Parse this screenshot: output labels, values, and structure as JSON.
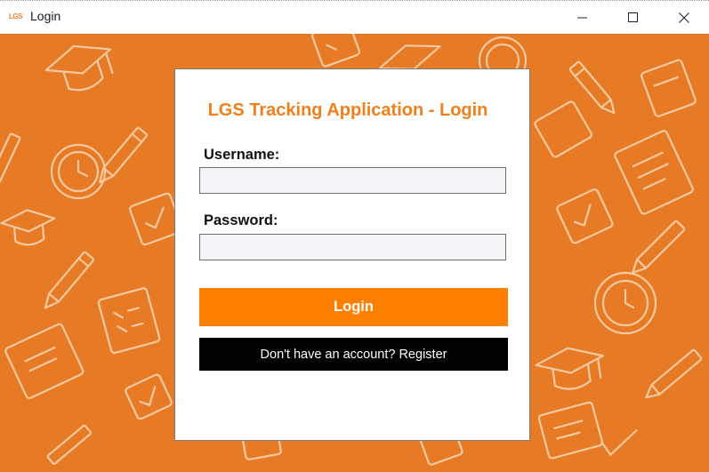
{
  "window": {
    "title": "Login",
    "logo_text": "LGS",
    "icons": {
      "minimize": "minimize-icon",
      "maximize": "maximize-icon",
      "close": "close-icon"
    }
  },
  "background": {
    "color": "#e77a25",
    "pattern_icons": [
      "graduation-cap-icon",
      "pencil-icon",
      "clock-icon",
      "document-icon",
      "checklist-icon"
    ]
  },
  "login": {
    "title": "LGS Tracking Application - Login",
    "username_label": "Username:",
    "username_value": "",
    "password_label": "Password:",
    "password_value": "",
    "login_button": "Login",
    "register_button": "Don't have an account? Register"
  },
  "colors": {
    "accent": "#ff7f00",
    "title": "#f0801c",
    "register_bg": "#000000"
  }
}
